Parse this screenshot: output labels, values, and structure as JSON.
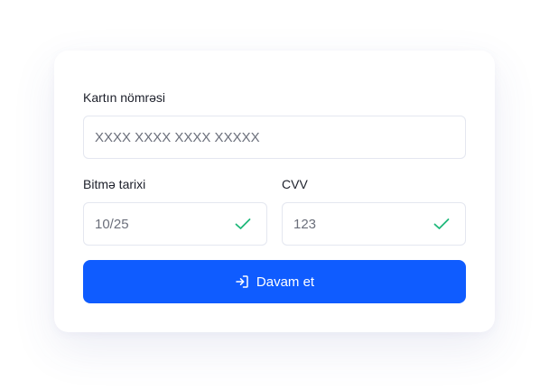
{
  "form": {
    "card_number": {
      "label": "Kartın nömrəsi",
      "placeholder": "XXXX XXXX XXXX XXXXX"
    },
    "expiry": {
      "label": "Bitmə tarixi",
      "value": "10/25",
      "status_icon": "check-icon",
      "valid": true
    },
    "cvv": {
      "label": "CVV",
      "value": "123",
      "status_icon": "check-icon",
      "valid": true
    },
    "submit": {
      "label": "Davam et",
      "icon": "sign-in-icon"
    }
  },
  "colors": {
    "accent": "#0f5cff",
    "valid": "#1fb87a",
    "border": "#e4e7f0",
    "text": "#1c1f2a",
    "muted": "#6b6f7b"
  }
}
